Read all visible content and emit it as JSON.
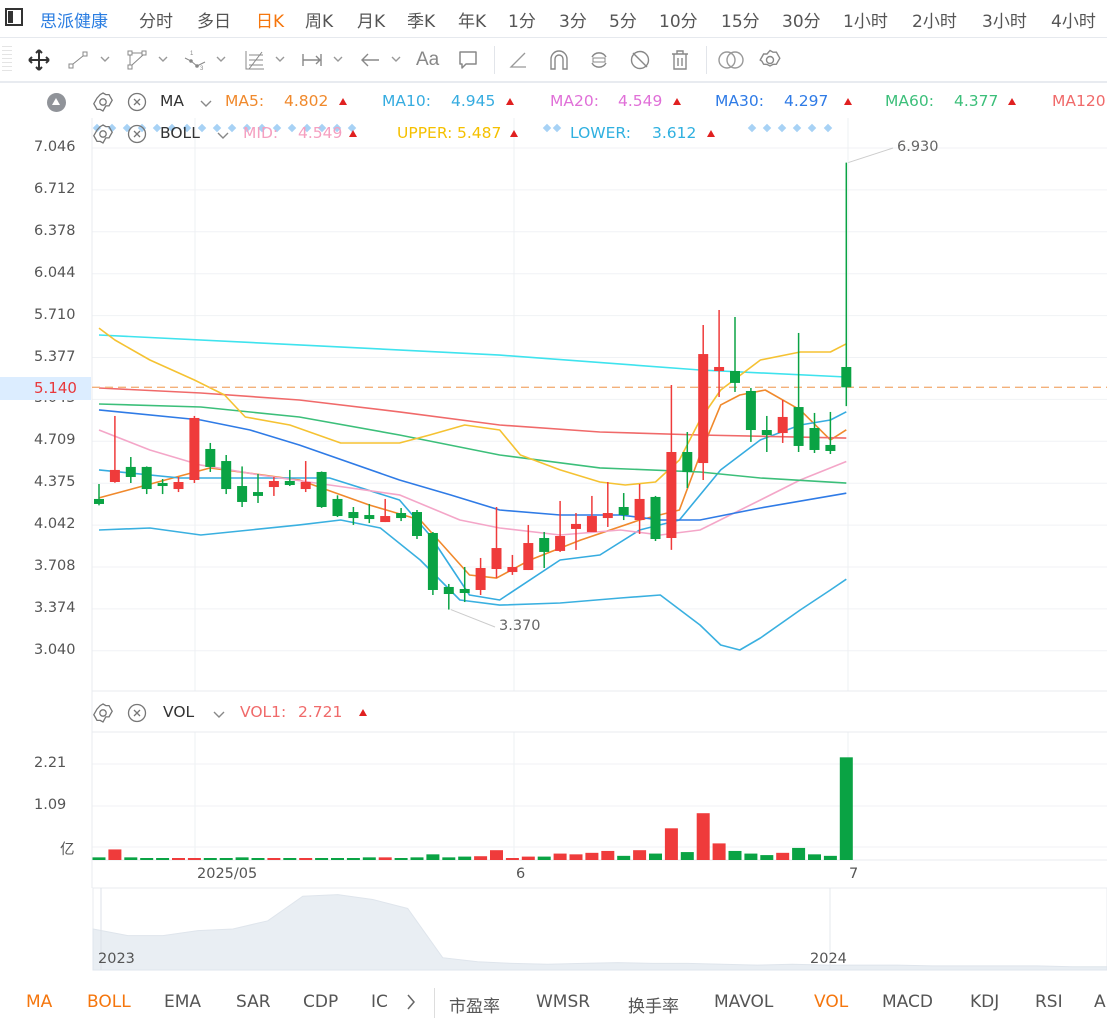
{
  "header": {
    "stock_name": "思派健康",
    "periods": [
      "分时",
      "多日",
      "日K",
      "周K",
      "月K",
      "季K",
      "年K",
      "1分",
      "3分",
      "5分",
      "10分",
      "15分",
      "30分",
      "1小时",
      "2小时",
      "3小时",
      "4小时"
    ],
    "active_period": "日K"
  },
  "toolbar": {
    "icons": [
      "move-icon",
      "line-icon",
      "polyline-icon",
      "wave-icon",
      "fibonacci-icon",
      "range-icon",
      "arrow-icon",
      "text-icon",
      "comment-icon",
      "angle-icon",
      "magnet-icon",
      "sync-icon",
      "hide-icon",
      "trash-icon",
      "compare-icon",
      "settings-icon"
    ],
    "text_tool_label": "Aa"
  },
  "legend_ma": {
    "name": "MA",
    "items": [
      {
        "label": "MA5:",
        "value": "4.802",
        "color": "#f0892c"
      },
      {
        "label": "MA10:",
        "value": "4.945",
        "color": "#36ace0"
      },
      {
        "label": "MA20:",
        "value": "4.549",
        "color": "#e070d8"
      },
      {
        "label": "MA30:",
        "value": "4.297",
        "color": "#2f7be6"
      },
      {
        "label": "MA60:",
        "value": "4.377",
        "color": "#3cbf7a"
      },
      {
        "label": "MA120",
        "value": "",
        "color": "#f06a6a"
      }
    ]
  },
  "legend_boll": {
    "name": "BOLL",
    "items": [
      {
        "label": "MID:",
        "value": "4.549",
        "color": "#f5a0c0"
      },
      {
        "label": "UPPER:",
        "value": "5.487",
        "color": "#f5c000"
      },
      {
        "label": "LOWER:",
        "value": "3.612",
        "color": "#2fb0e0"
      }
    ]
  },
  "legend_vol": {
    "name": "VOL",
    "items": [
      {
        "label": "VOL1:",
        "value": "2.721",
        "color": "#f06a6a"
      }
    ]
  },
  "price_axis": [
    "7.046",
    "6.712",
    "6.378",
    "6.044",
    "5.710",
    "5.377",
    "5.043",
    "4.709",
    "4.375",
    "4.042",
    "3.708",
    "3.374",
    "3.040"
  ],
  "current_price": "5.140",
  "max_label": "6.930",
  "min_label": "3.370",
  "volume_axis": [
    "2.21",
    "1.09",
    "亿"
  ],
  "time_axis": [
    "2025/05",
    "6",
    "7"
  ],
  "navigator": {
    "labels": [
      "2023",
      "2024"
    ],
    "values": [
      0.5,
      0.42,
      0.42,
      0.48,
      0.5,
      0.6,
      0.9,
      0.92,
      0.86,
      0.75,
      0.15,
      0.1,
      0.08,
      0.07,
      0.08,
      0.09,
      0.08,
      0.08,
      0.07,
      0.06,
      0.07,
      0.06,
      0.06,
      0.06,
      0.05,
      0.05,
      0.05,
      0.05,
      0.04,
      0.04
    ]
  },
  "indicator_tabs": {
    "left": [
      "MA",
      "BOLL",
      "EMA",
      "SAR",
      "CDP",
      "IC"
    ],
    "right": [
      "市盈率",
      "WMSR",
      "换手率",
      "MAVOL",
      "VOL",
      "MACD",
      "KDJ",
      "RSI",
      "A"
    ],
    "active": [
      "MA",
      "BOLL",
      "VOL"
    ]
  },
  "colors": {
    "up": "#ef3b3b",
    "down": "#0aa344",
    "brand": "#2a7de1",
    "accent": "#f5760d"
  },
  "chart_data": {
    "type": "candlestick",
    "ylim": [
      3.04,
      7.046
    ],
    "candles": [
      [
        4.251,
        4.37,
        4.2,
        4.211
      ],
      [
        4.386,
        4.912,
        4.38,
        4.482
      ],
      [
        4.506,
        4.585,
        4.378,
        4.426
      ],
      [
        4.506,
        4.51,
        4.29,
        4.33
      ],
      [
        4.378,
        4.41,
        4.29,
        4.354
      ],
      [
        4.33,
        4.426,
        4.306,
        4.386
      ],
      [
        4.402,
        4.912,
        4.378,
        4.896
      ],
      [
        4.649,
        4.697,
        4.466,
        4.506
      ],
      [
        4.553,
        4.601,
        4.29,
        4.33
      ],
      [
        4.354,
        4.51,
        4.187,
        4.227
      ],
      [
        4.306,
        4.45,
        4.219,
        4.275
      ],
      [
        4.346,
        4.426,
        4.275,
        4.394
      ],
      [
        4.394,
        4.482,
        4.354,
        4.362
      ],
      [
        4.33,
        4.553,
        4.306,
        4.386
      ],
      [
        4.466,
        4.47,
        4.18,
        4.187
      ],
      [
        4.251,
        4.28,
        4.107,
        4.115
      ],
      [
        4.147,
        4.187,
        4.044,
        4.099
      ],
      [
        4.123,
        4.211,
        4.059,
        4.091
      ],
      [
        4.067,
        4.251,
        4.067,
        4.115
      ],
      [
        4.139,
        4.179,
        4.075,
        4.099
      ],
      [
        4.147,
        4.163,
        3.932,
        3.956
      ],
      [
        3.98,
        3.988,
        3.486,
        3.526
      ],
      [
        3.55,
        3.574,
        3.37,
        3.494
      ],
      [
        3.534,
        3.709,
        3.43,
        3.502
      ],
      [
        3.526,
        3.781,
        3.486,
        3.701
      ],
      [
        3.693,
        4.187,
        3.622,
        3.86
      ],
      [
        3.669,
        3.805,
        3.646,
        3.709
      ],
      [
        3.685,
        4.044,
        3.685,
        3.9
      ],
      [
        3.94,
        3.988,
        3.701,
        3.829
      ],
      [
        3.837,
        4.235,
        3.829,
        3.956
      ],
      [
        4.012,
        4.139,
        3.845,
        4.052
      ],
      [
        3.988,
        4.275,
        3.988,
        4.115
      ],
      [
        4.099,
        4.386,
        4.028,
        4.139
      ],
      [
        4.187,
        4.298,
        4.083,
        4.123
      ],
      [
        4.083,
        4.37,
        3.972,
        4.251
      ],
      [
        4.267,
        4.275,
        3.916,
        3.932
      ],
      [
        3.94,
        5.159,
        3.845,
        4.625
      ],
      [
        4.625,
        4.784,
        4.338,
        4.466
      ],
      [
        4.537,
        5.636,
        4.402,
        5.405
      ],
      [
        5.27,
        5.756,
        5.063,
        5.302
      ],
      [
        5.27,
        5.7,
        5.103,
        5.175
      ],
      [
        5.111,
        5.135,
        4.705,
        4.8
      ],
      [
        4.8,
        4.912,
        4.625,
        4.76
      ],
      [
        4.776,
        5.039,
        4.697,
        4.904
      ],
      [
        4.983,
        5.573,
        4.625,
        4.673
      ],
      [
        4.816,
        4.936,
        4.617,
        4.641
      ],
      [
        4.681,
        4.944,
        4.609,
        4.633
      ],
      [
        5.302,
        6.93,
        4.99,
        5.14
      ]
    ],
    "volume": [
      0.07,
      0.28,
      0.07,
      0.04,
      0.04,
      0.05,
      0.03,
      0.04,
      0.04,
      0.07,
      0.04,
      0.05,
      0.04,
      0.05,
      0.04,
      0.04,
      0.04,
      0.07,
      0.07,
      0.04,
      0.07,
      0.15,
      0.07,
      0.09,
      0.1,
      0.26,
      0.03,
      0.09,
      0.09,
      0.17,
      0.15,
      0.19,
      0.24,
      0.11,
      0.26,
      0.17,
      0.84,
      0.21,
      1.24,
      0.44,
      0.24,
      0.17,
      0.13,
      0.19,
      0.32,
      0.15,
      0.11,
      2.721
    ],
    "lines": [
      {
        "name": "MA5",
        "color": "#f0892c",
        "points": [
          [
            0,
            4.259
          ],
          [
            7,
            4.498
          ],
          [
            12.6,
            4.402
          ],
          [
            17,
            4.203
          ],
          [
            20.2,
            4.083
          ],
          [
            23.3,
            3.645
          ],
          [
            25,
            3.621
          ],
          [
            27.1,
            3.765
          ],
          [
            30.3,
            3.924
          ],
          [
            34,
            4.083
          ],
          [
            36.5,
            4.163
          ],
          [
            37.8,
            4.601
          ],
          [
            39.1,
            5.0
          ],
          [
            40.3,
            5.079
          ],
          [
            41.9,
            5.119
          ],
          [
            44.1,
            4.96
          ],
          [
            46,
            4.721
          ],
          [
            47,
            4.802
          ]
        ]
      },
      {
        "name": "MA10",
        "color": "#36ace0",
        "points": [
          [
            0,
            4.482
          ],
          [
            5.1,
            4.418
          ],
          [
            8.9,
            4.418
          ],
          [
            14.5,
            4.418
          ],
          [
            18.9,
            4.243
          ],
          [
            20.8,
            3.964
          ],
          [
            23.3,
            3.486
          ],
          [
            25.2,
            3.446
          ],
          [
            29,
            3.765
          ],
          [
            31.5,
            3.805
          ],
          [
            34,
            4.004
          ],
          [
            36.5,
            4.083
          ],
          [
            39.1,
            4.482
          ],
          [
            41.6,
            4.721
          ],
          [
            44.1,
            4.84
          ],
          [
            46,
            4.88
          ],
          [
            47,
            4.945
          ]
        ]
      },
      {
        "name": "MA20",
        "color": "#f4a6c8",
        "points": [
          [
            0,
            4.8
          ],
          [
            3.2,
            4.641
          ],
          [
            6.4,
            4.521
          ],
          [
            10.1,
            4.442
          ],
          [
            14.5,
            4.362
          ],
          [
            18.9,
            4.283
          ],
          [
            22.7,
            4.083
          ],
          [
            25.2,
            4.02
          ],
          [
            29,
            3.964
          ],
          [
            32.8,
            4.004
          ],
          [
            35.3,
            3.964
          ],
          [
            37.8,
            4.004
          ],
          [
            41.6,
            4.243
          ],
          [
            44.1,
            4.402
          ],
          [
            47,
            4.549
          ]
        ]
      },
      {
        "name": "MA30",
        "color": "#2f7be6",
        "points": [
          [
            0,
            4.96
          ],
          [
            6.4,
            4.88
          ],
          [
            9.5,
            4.8
          ],
          [
            12.6,
            4.681
          ],
          [
            18.9,
            4.402
          ],
          [
            22.1,
            4.283
          ],
          [
            25.2,
            4.163
          ],
          [
            29,
            4.123
          ],
          [
            32.8,
            4.123
          ],
          [
            35.3,
            4.083
          ],
          [
            37.8,
            4.083
          ],
          [
            41.6,
            4.179
          ],
          [
            47,
            4.297
          ]
        ]
      },
      {
        "name": "MA60",
        "color": "#3cbf7a",
        "points": [
          [
            0,
            5.007
          ],
          [
            6.4,
            4.983
          ],
          [
            12.6,
            4.904
          ],
          [
            18.9,
            4.76
          ],
          [
            25.2,
            4.601
          ],
          [
            31.5,
            4.498
          ],
          [
            37.8,
            4.466
          ],
          [
            41.6,
            4.418
          ],
          [
            47,
            4.377
          ]
        ]
      },
      {
        "name": "MA120",
        "color": "#f06a6a",
        "points": [
          [
            0,
            5.135
          ],
          [
            6.4,
            5.095
          ],
          [
            12.6,
            5.039
          ],
          [
            18.9,
            4.944
          ],
          [
            25.2,
            4.84
          ],
          [
            31.5,
            4.784
          ],
          [
            37.8,
            4.76
          ],
          [
            47,
            4.736
          ]
        ]
      },
      {
        "name": "",
        "color": "#3fe3ee",
        "points": [
          [
            0,
            5.557
          ],
          [
            12.6,
            5.478
          ],
          [
            25.2,
            5.397
          ],
          [
            37.8,
            5.278
          ],
          [
            47,
            5.222
          ]
        ]
      },
      {
        "name": "UPPER",
        "color": "#f5c232",
        "points": [
          [
            0,
            5.612
          ],
          [
            1,
            5.517
          ],
          [
            3.2,
            5.358
          ],
          [
            6,
            5.198
          ],
          [
            7.9,
            5.079
          ],
          [
            9.2,
            4.904
          ],
          [
            12,
            4.84
          ],
          [
            15.2,
            4.697
          ],
          [
            18.9,
            4.697
          ],
          [
            20.8,
            4.76
          ],
          [
            23,
            4.84
          ],
          [
            25.2,
            4.8
          ],
          [
            26.5,
            4.601
          ],
          [
            29,
            4.482
          ],
          [
            31.5,
            4.386
          ],
          [
            33.1,
            4.362
          ],
          [
            35,
            4.386
          ],
          [
            36.5,
            4.561
          ],
          [
            37.8,
            4.88
          ],
          [
            39.1,
            5.119
          ],
          [
            41.6,
            5.358
          ],
          [
            44.1,
            5.421
          ],
          [
            46,
            5.421
          ],
          [
            47,
            5.487
          ]
        ]
      },
      {
        "name": "LOWER",
        "color": "#3ab0e0",
        "points": [
          [
            0,
            4.004
          ],
          [
            3.2,
            4.02
          ],
          [
            6.4,
            3.964
          ],
          [
            9.5,
            4.004
          ],
          [
            12.6,
            4.044
          ],
          [
            15.2,
            4.083
          ],
          [
            17.7,
            4.02
          ],
          [
            20.2,
            3.765
          ],
          [
            22.7,
            3.446
          ],
          [
            25.2,
            3.406
          ],
          [
            29,
            3.422
          ],
          [
            32.8,
            3.462
          ],
          [
            35.3,
            3.486
          ],
          [
            37.8,
            3.247
          ],
          [
            39.1,
            3.088
          ],
          [
            40.3,
            3.048
          ],
          [
            41.6,
            3.144
          ],
          [
            44.1,
            3.367
          ],
          [
            46,
            3.526
          ],
          [
            47,
            3.612
          ]
        ]
      }
    ]
  }
}
